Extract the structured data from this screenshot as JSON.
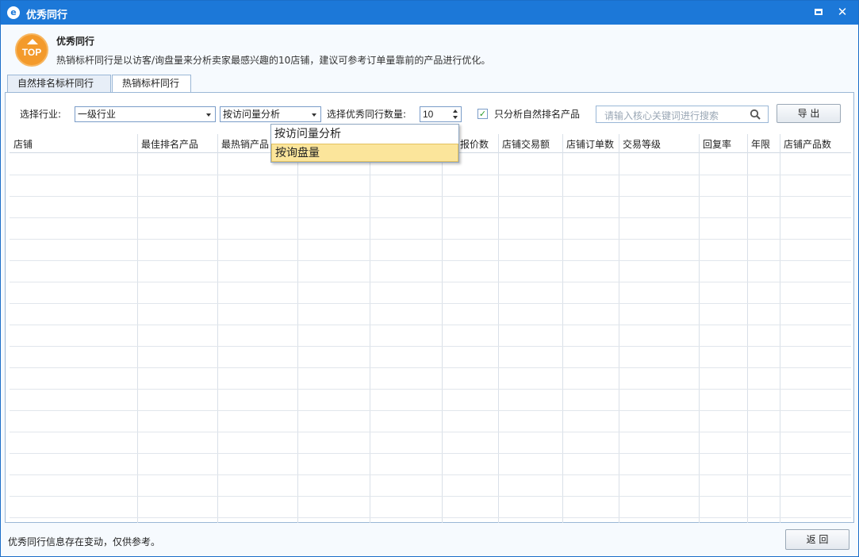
{
  "window": {
    "title": "优秀同行",
    "icon": "app-logo-icon",
    "maximize_icon": "maximize-icon",
    "close_glyph": "✕"
  },
  "header": {
    "badge_text": "TOP",
    "title": "优秀同行",
    "description": "热销标杆同行是以访客/询盘量来分析卖家最感兴趣的10店铺，建议可参考订单量靠前的产品进行优化。"
  },
  "tabs": [
    {
      "label": "自然排名标杆同行",
      "selected": false
    },
    {
      "label": "热销标杆同行",
      "selected": true
    }
  ],
  "filters": {
    "industry_label": "选择行业:",
    "industry_value": "一级行业",
    "mode_value": "按访问量分析",
    "count_label": "选择优秀同行数量:",
    "count_value": "10",
    "natural_only_checked": true,
    "natural_only_label": "只分析自然排名产品",
    "search_placeholder": "请输入核心关键词进行搜索",
    "export_label": "导 出"
  },
  "mode_dropdown": {
    "options": [
      "按访问量分析",
      "按询盘量"
    ],
    "highlighted": "按询盘量"
  },
  "table": {
    "columns": [
      "店铺",
      "最佳排名产品",
      "最热销产品",
      "",
      "",
      "报价数",
      "店铺交易额",
      "店铺订单数",
      "交易等级",
      "回复率",
      "年限",
      "店铺产品数"
    ],
    "rows": []
  },
  "footer": {
    "note": "优秀同行信息存在变动，仅供参考。",
    "back_label": "返 回"
  },
  "colors": {
    "titlebar": "#1c78d8",
    "badge": "#f39a2b",
    "highlight": "#fbe59b",
    "check": "#2a9a2a"
  }
}
